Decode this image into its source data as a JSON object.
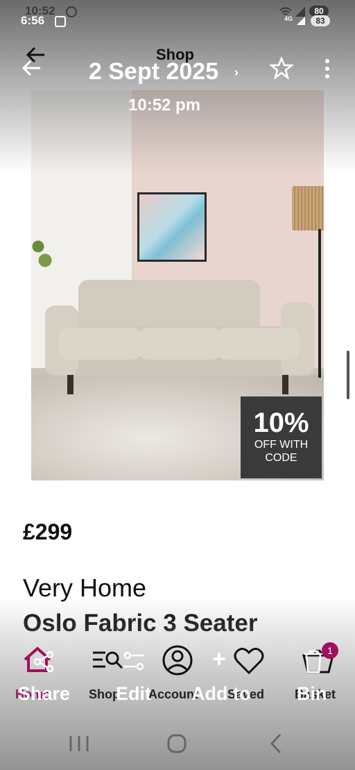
{
  "status_bar": {
    "time_behind": "10:52",
    "time": "6:56",
    "battery_behind": "80",
    "battery": "83",
    "network": "4G"
  },
  "header": {
    "title": "Shop"
  },
  "overlay": {
    "date": "2 Sept 2025",
    "time": "10:52 pm"
  },
  "product": {
    "image_icon": "sofa-photo",
    "promo_percent": "10%",
    "promo_line1": "OFF WITH",
    "promo_line2": "CODE",
    "price": "£299",
    "brand": "Very Home",
    "name": "Oslo Fabric 3 Seater"
  },
  "bottom_nav": {
    "home": "Home",
    "shop": "Shop",
    "account": "Account",
    "saved": "Saved",
    "basket": "Basket",
    "basket_count": "1"
  },
  "gallery_actions": {
    "share": "Share",
    "edit": "Edit",
    "add_to": "Add to",
    "bin": "Bin"
  },
  "colors": {
    "accent": "#a0105d",
    "text": "#111111",
    "badge_bg": "#3a3a3a"
  }
}
